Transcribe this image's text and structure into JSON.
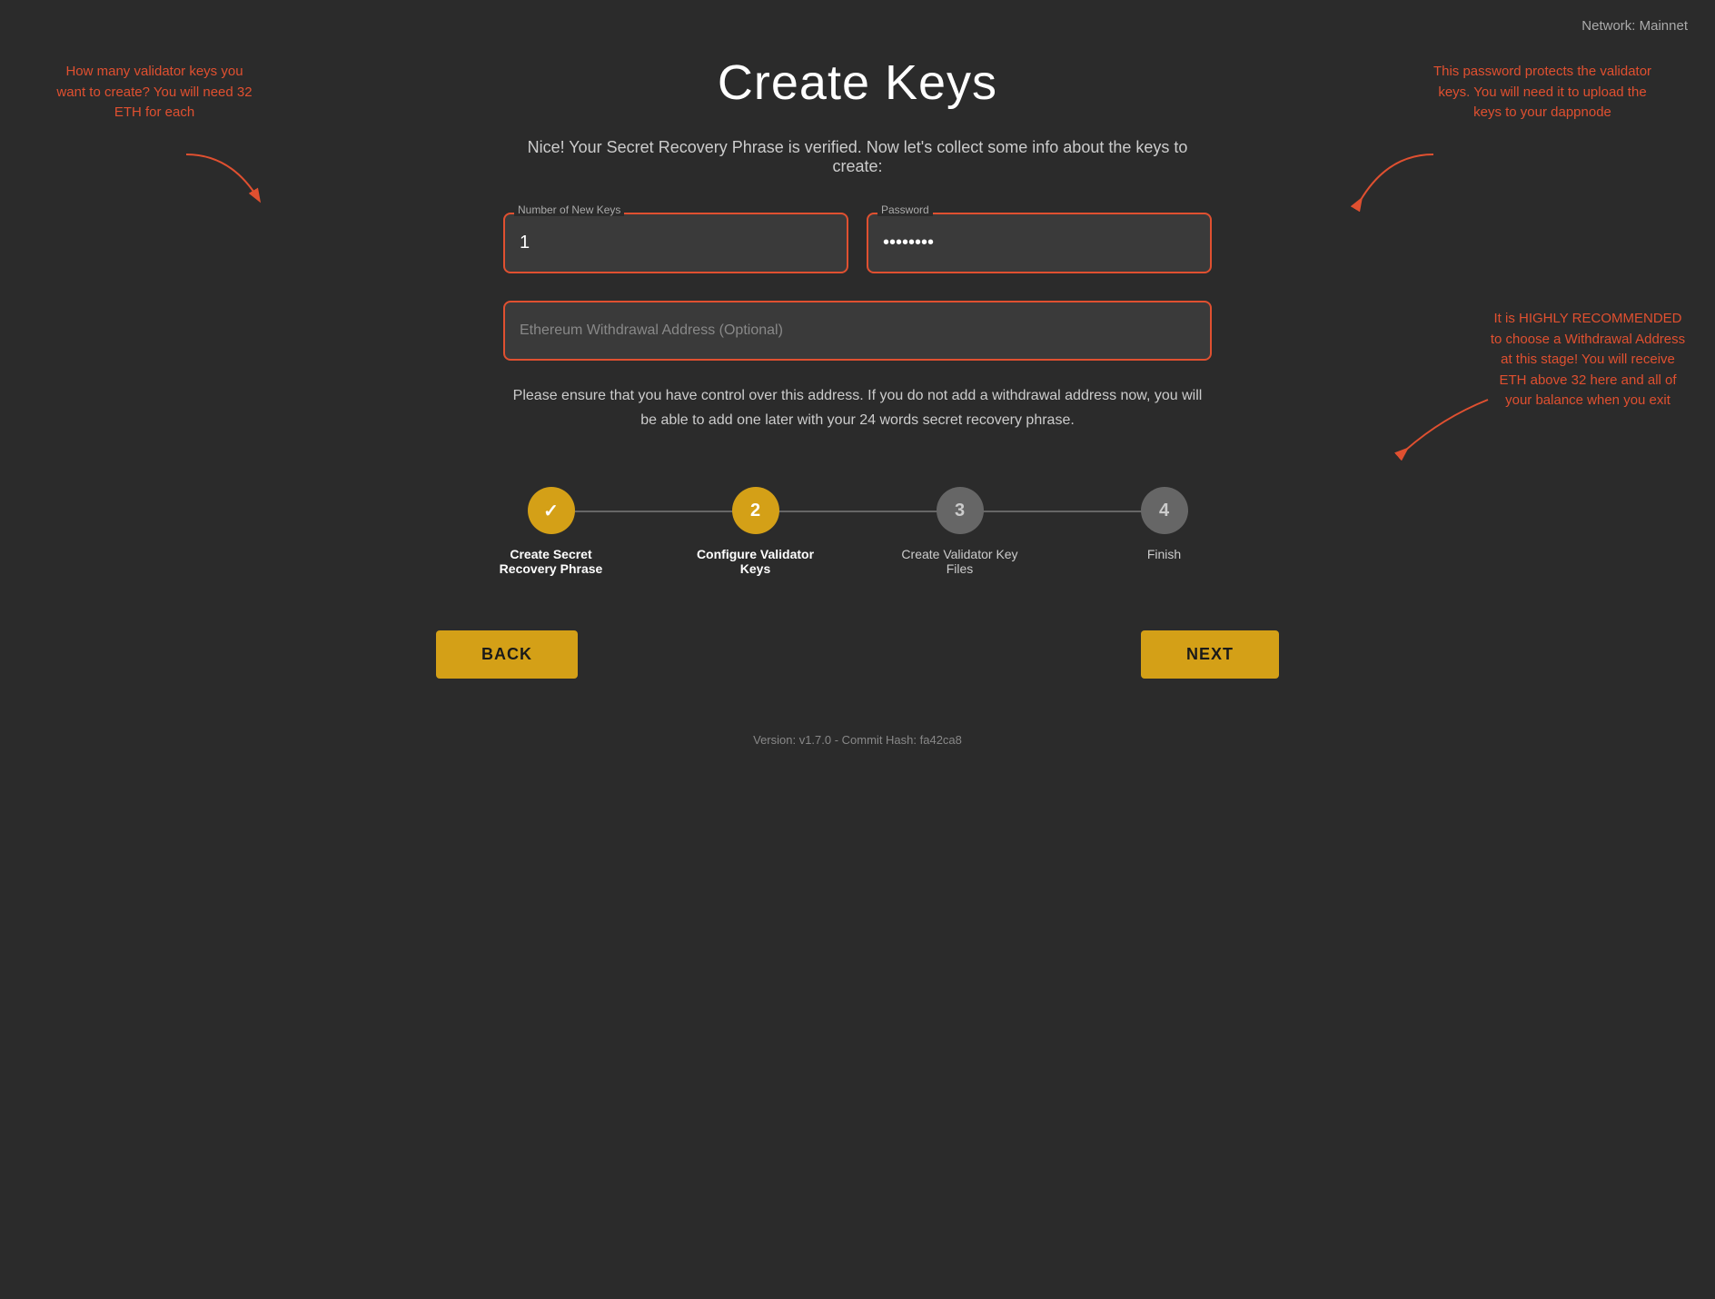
{
  "network": {
    "label": "Network: Mainnet"
  },
  "page": {
    "title": "Create Keys",
    "subtitle": "Nice! Your Secret Recovery Phrase is verified. Now let's collect some info about the keys to create:"
  },
  "annotations": {
    "left": "How many validator keys you want to create? You will need 32 ETH for each",
    "right_top": "This password protects the validator keys. You will need it to upload the keys to your dappnode",
    "right_bottom": "It is HIGHLY RECOMMENDED to choose a Withdrawal Address at this stage! You will receive ETH above 32 here and all of your balance when you exit"
  },
  "form": {
    "num_keys_label": "Number of New Keys",
    "num_keys_value": "1",
    "password_label": "Password",
    "password_value": "········",
    "withdrawal_placeholder": "Ethereum Withdrawal Address (Optional)"
  },
  "disclaimer": "Please ensure that you have control over this address. If you do not add a withdrawal address now, you will be able to add one later with your 24 words secret recovery phrase.",
  "stepper": {
    "steps": [
      {
        "number": "✓",
        "label": "Create Secret Recovery Phrase",
        "state": "completed",
        "bold": true
      },
      {
        "number": "2",
        "label": "Configure Validator Keys",
        "state": "active",
        "bold": true
      },
      {
        "number": "3",
        "label": "Create Validator Key Files",
        "state": "inactive",
        "bold": false
      },
      {
        "number": "4",
        "label": "Finish",
        "state": "inactive",
        "bold": false
      }
    ]
  },
  "buttons": {
    "back": "BACK",
    "next": "NEXT"
  },
  "footer": {
    "version": "Version: v1.7.0 - Commit Hash: fa42ca8"
  }
}
